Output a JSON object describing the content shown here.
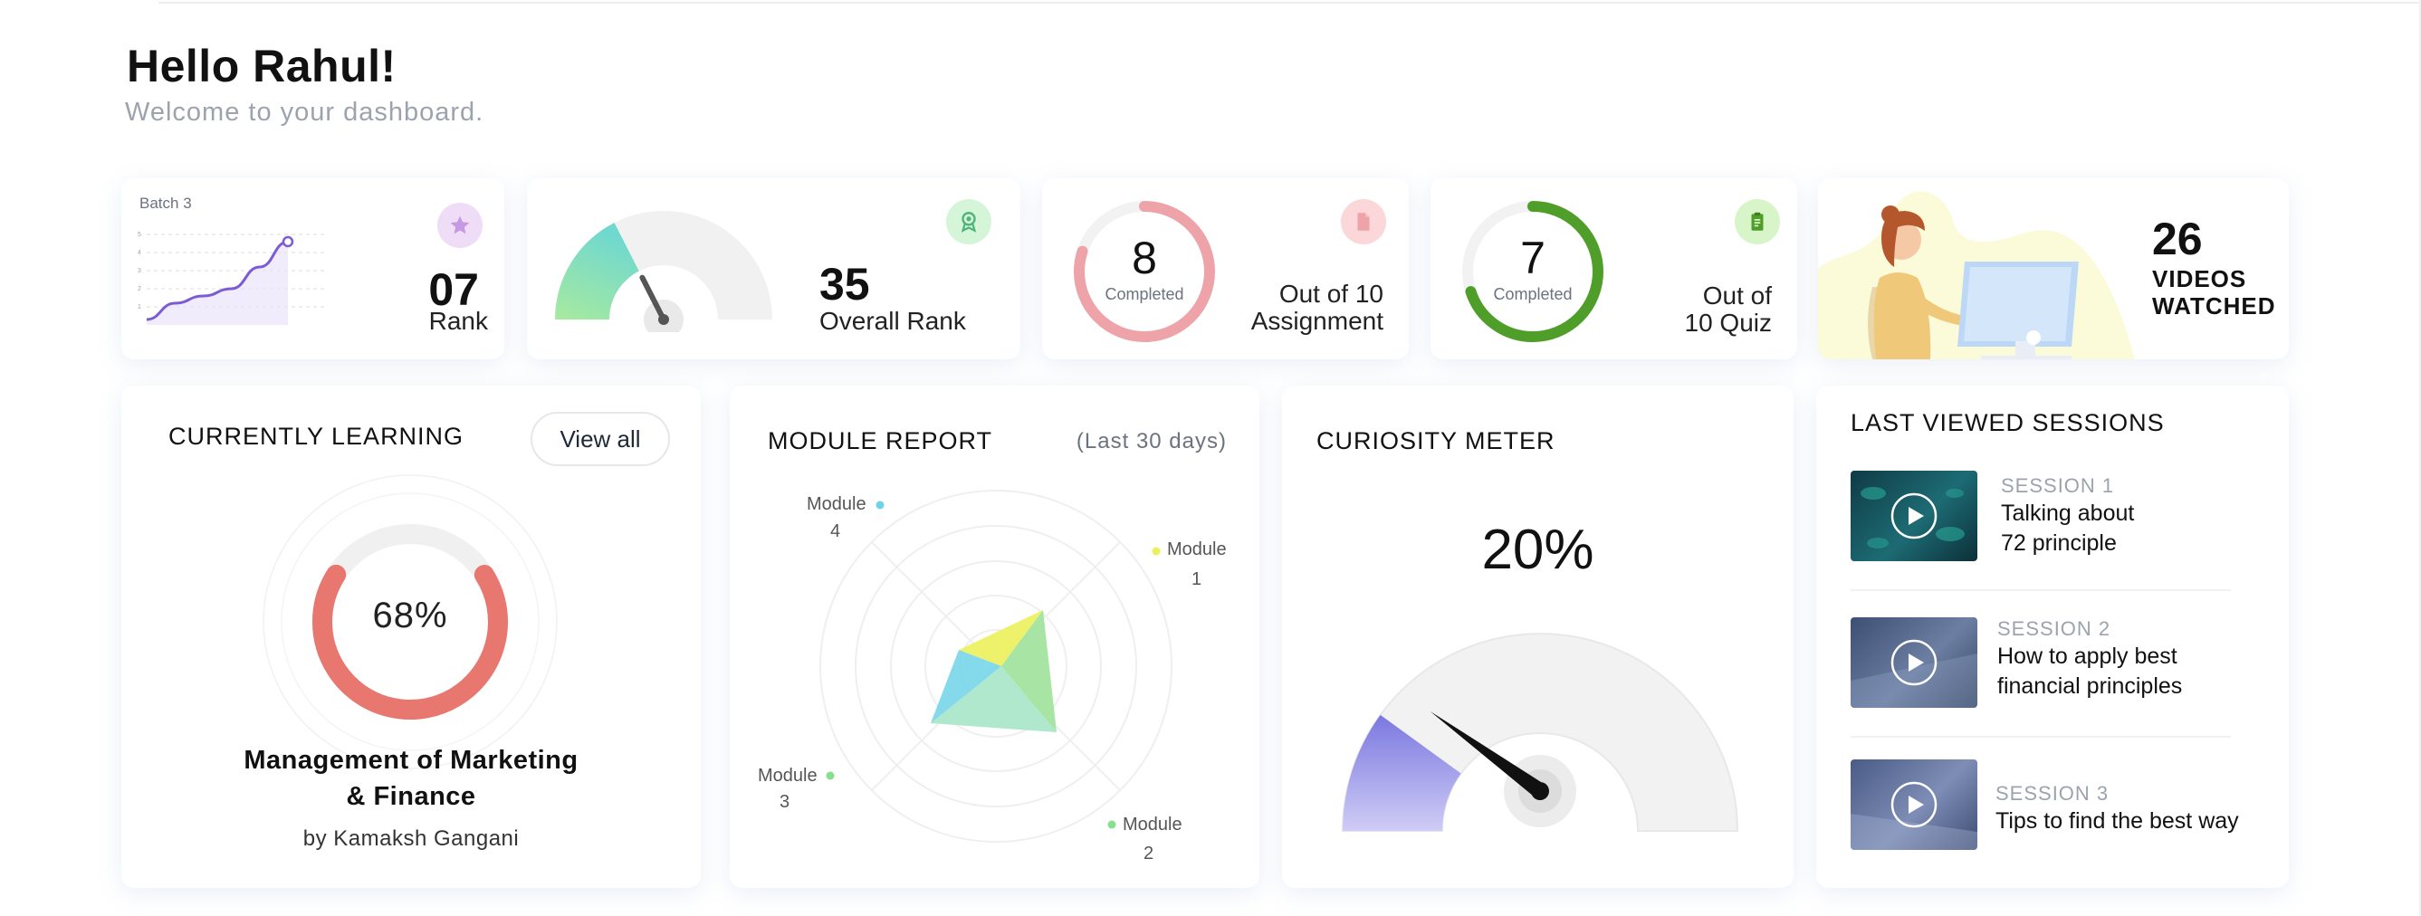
{
  "header": {
    "greeting": "Hello Rahul!",
    "subtitle": "Welcome to your dashboard."
  },
  "stats": {
    "rank": {
      "batch_label": "Batch 3",
      "value": "07",
      "label": "Rank",
      "icon": "star-icon",
      "chart_data": {
        "type": "line",
        "values": [
          0.3,
          1.2,
          1.6,
          2.0,
          3.2,
          4.6
        ],
        "ylim": [
          0,
          5
        ]
      }
    },
    "overall_rank": {
      "value": "35",
      "label": "Overall Rank",
      "icon": "award-icon",
      "gauge_fraction": 0.35
    },
    "assignment": {
      "value": "8",
      "sublabel": "Completed",
      "line1": "Out of 10",
      "line2": "Assignment",
      "icon": "document-icon",
      "fraction": 0.8
    },
    "quiz": {
      "value": "7",
      "sublabel": "Completed",
      "line1": "Out of",
      "line2": "10 Quiz",
      "icon": "clipboard-icon",
      "fraction": 0.7
    },
    "videos": {
      "value": "26",
      "line1": "VIDEOS",
      "line2": "WATCHED"
    }
  },
  "currently_learning": {
    "title": "CURRENTLY LEARNING",
    "view_all": "View all",
    "percent": "68%",
    "fraction": 0.68,
    "course_line1": "Management of Marketing",
    "course_line2": "& Finance",
    "author": "by Kamaksh Gangani"
  },
  "module_report": {
    "title": "MODULE REPORT",
    "period": "(Last 30 days)",
    "modules": [
      {
        "label": "Module",
        "number": "1"
      },
      {
        "label": "Module",
        "number": "2"
      },
      {
        "label": "Module",
        "number": "3"
      },
      {
        "label": "Module",
        "number": "4"
      }
    ],
    "colors": {
      "m1": "#ecf05a",
      "m2": "#9ee29a",
      "m3": "#86e08c",
      "m4": "#6fd3e6"
    }
  },
  "curiosity": {
    "title": "CURIOSITY METER",
    "percent": "20%",
    "fraction": 0.2
  },
  "sessions": {
    "title": "LAST VIEWED SESSIONS",
    "items": [
      {
        "label": "SESSION 1",
        "title_line1": "Talking about",
        "title_line2": "72 principle"
      },
      {
        "label": "SESSION 2",
        "title_line1": "How to apply best",
        "title_line2": "financial principles"
      },
      {
        "label": "SESSION 3",
        "title_line1": "Tips to find the best way",
        "title_line2": ""
      }
    ]
  },
  "colors": {
    "rank_line": "#7c5cd6",
    "assignment_ring": "#eea3a8",
    "quiz_ring": "#4f9e2a",
    "learning_ring": "#e8776f",
    "accent_purple": "#7b78e0"
  }
}
